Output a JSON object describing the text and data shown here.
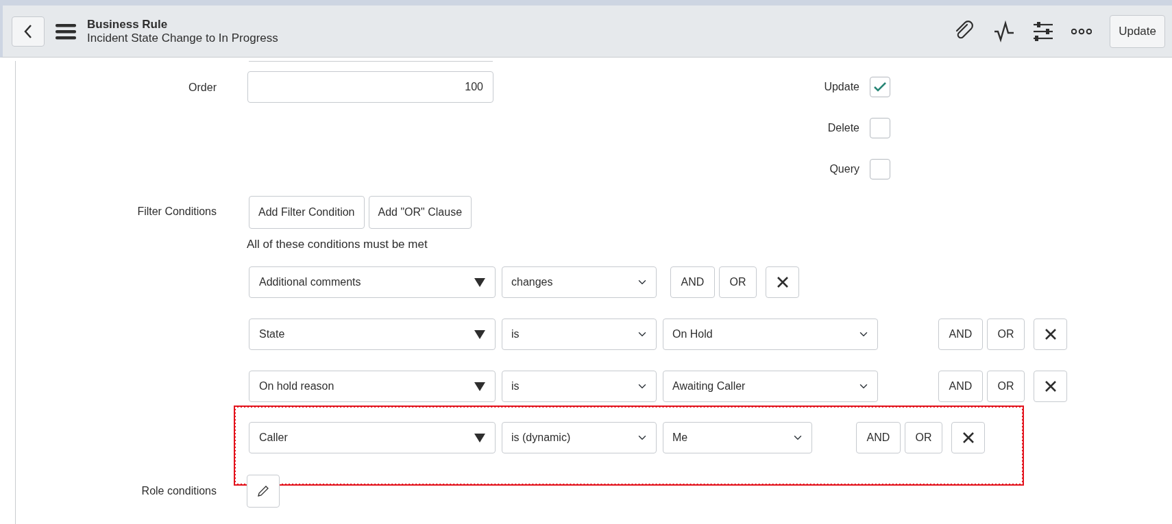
{
  "header": {
    "title": "Business Rule",
    "subtitle": "Incident State Change to In Progress",
    "action_button": "Update"
  },
  "form": {
    "order": {
      "label": "Order",
      "value": "100"
    },
    "checkboxes": [
      {
        "label": "Update",
        "checked": true
      },
      {
        "label": "Delete",
        "checked": false
      },
      {
        "label": "Query",
        "checked": false
      }
    ],
    "filter": {
      "label": "Filter Conditions",
      "buttons": [
        "Add Filter Condition",
        "Add \"OR\" Clause"
      ],
      "summary": "All of these conditions must be met",
      "conditions": [
        {
          "kind": "change",
          "field": "Additional comments",
          "operator": "changes",
          "and": "AND",
          "or": "OR",
          "highlighted": false
        },
        {
          "kind": "choice",
          "field": "State",
          "operator": "is",
          "value": "On Hold",
          "and": "AND",
          "or": "OR",
          "highlighted": false
        },
        {
          "kind": "choice",
          "field": "On hold reason",
          "operator": "is",
          "value": "Awaiting Caller",
          "and": "AND",
          "or": "OR",
          "highlighted": false
        },
        {
          "kind": "dynamic",
          "field": "Caller",
          "operator": "is (dynamic)",
          "value": "Me",
          "and": "AND",
          "or": "OR",
          "highlighted": true
        }
      ]
    },
    "role_conditions": {
      "label": "Role conditions"
    }
  }
}
